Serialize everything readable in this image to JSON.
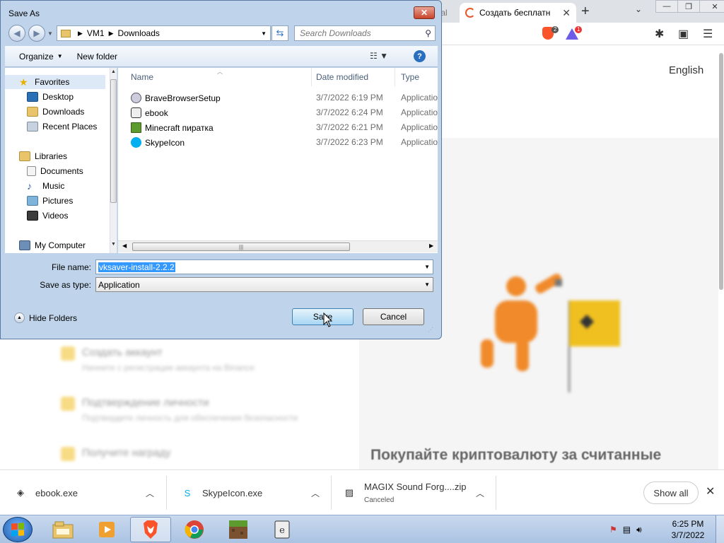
{
  "browser": {
    "tab_partial": "tal",
    "active_tab": "Создать бесплатн",
    "shield_badge": "2",
    "rewards_badge": "1",
    "language": "English",
    "steps": [
      {
        "title": "Создать аккаунт",
        "subtitle": "Начните с регистрации аккаунта на Binance"
      },
      {
        "title": "Подтверждение личности",
        "subtitle": "Подтвердите личность для обеспечения безопасности"
      },
      {
        "title": "Получите награду",
        "subtitle": ""
      }
    ],
    "promo": "Покупайте криптовалюту за считанные"
  },
  "downloads": {
    "items": [
      {
        "name": "ebook.exe",
        "status": "",
        "icon": "ebook-icon"
      },
      {
        "name": "SkypeIcon.exe",
        "status": "",
        "icon": "skype-icon"
      },
      {
        "name": "MAGIX Sound Forg....zip",
        "status": "Canceled",
        "icon": "zip-icon"
      }
    ],
    "show_all": "Show all"
  },
  "taskbar": {
    "apps": [
      "explorer-icon",
      "media-player-icon",
      "brave-icon",
      "chrome-icon",
      "minecraft-icon",
      "ebook-icon"
    ],
    "time": "6:25 PM",
    "date": "3/7/2022"
  },
  "dialog": {
    "title": "Save As",
    "breadcrumb": [
      "VM1",
      "Downloads"
    ],
    "search_placeholder": "Search Downloads",
    "organize": "Organize",
    "new_folder": "New folder",
    "tree": {
      "favorites": "Favorites",
      "desktop": "Desktop",
      "downloads": "Downloads",
      "recent_places": "Recent Places",
      "libraries": "Libraries",
      "documents": "Documents",
      "music": "Music",
      "pictures": "Pictures",
      "videos": "Videos",
      "my_computer": "My Computer"
    },
    "columns": {
      "name": "Name",
      "date": "Date modified",
      "type": "Type"
    },
    "files": [
      {
        "name": "BraveBrowserSetup",
        "date": "3/7/2022 6:19 PM",
        "type": "Applicatio"
      },
      {
        "name": "ebook",
        "date": "3/7/2022 6:24 PM",
        "type": "Applicatio"
      },
      {
        "name": "Minecraft пиратка",
        "date": "3/7/2022 6:21 PM",
        "type": "Applicatio"
      },
      {
        "name": "SkypeIcon",
        "date": "3/7/2022 6:23 PM",
        "type": "Applicatio"
      }
    ],
    "file_name_label": "File name:",
    "file_name": "vksaver-install-2.2.2",
    "save_type_label": "Save as type:",
    "save_type": "Application",
    "hide_folders": "Hide Folders",
    "save": "Save",
    "cancel": "Cancel"
  }
}
